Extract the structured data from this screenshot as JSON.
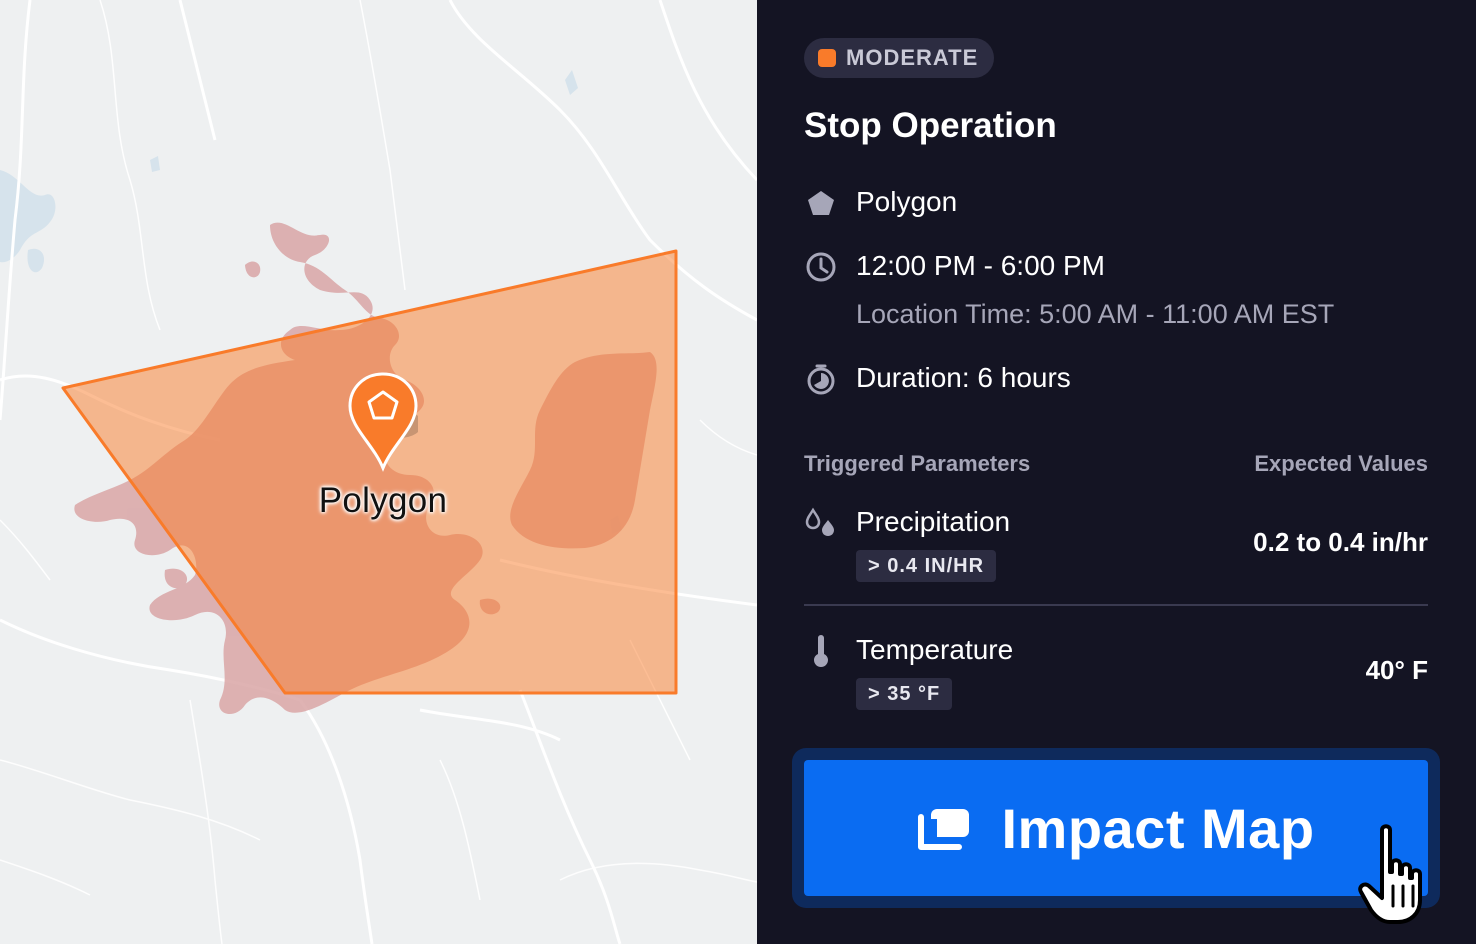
{
  "map": {
    "pin_label": "Polygon",
    "colors": {
      "area": "#f97b2a",
      "area_fill": "#f8b48b",
      "radar": "#d9a6a6",
      "water": "#d6e3ec",
      "road": "#ffffff"
    }
  },
  "panel": {
    "badge": {
      "label": "MODERATE",
      "color": "#f97b2a"
    },
    "title": "Stop Operation",
    "location": {
      "icon": "pentagon-icon",
      "label": "Polygon"
    },
    "time": {
      "icon": "clock-icon",
      "label": "12:00 PM - 6:00 PM",
      "location_time": "Location Time: 5:00 AM - 11:00 AM EST"
    },
    "duration": {
      "icon": "stopwatch-icon",
      "label": "Duration: 6 hours"
    },
    "columns": {
      "left": "Triggered Parameters",
      "right": "Expected Values"
    },
    "parameters": [
      {
        "icon": "droplets-icon",
        "name": "Precipitation",
        "threshold": "> 0.4 IN/HR",
        "expected": "0.2 to 0.4 in/hr"
      },
      {
        "icon": "thermometer-icon",
        "name": "Temperature",
        "threshold": "> 35 °F",
        "expected": "40° F"
      }
    ],
    "action_button": {
      "icon": "impact-map-icon",
      "label": "Impact Map",
      "color": "#0a6cf2"
    }
  }
}
